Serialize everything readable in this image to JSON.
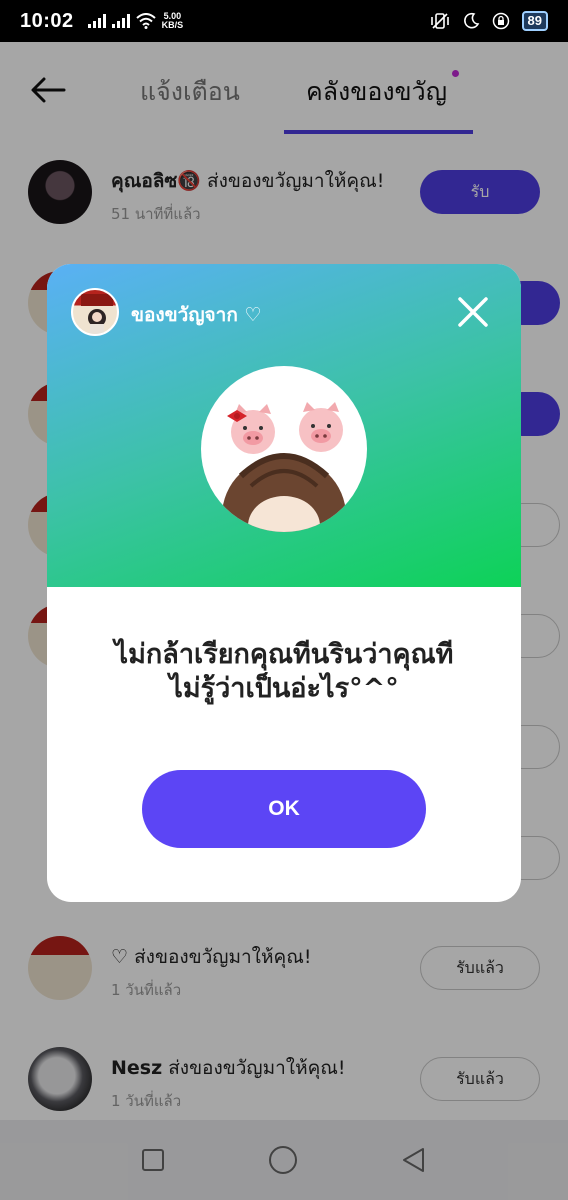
{
  "status_bar": {
    "time": "10:02",
    "speed_value": "5.00",
    "speed_unit": "KB/S",
    "battery": "89"
  },
  "header": {
    "tabs": [
      {
        "label": "แจ้งเตือน"
      },
      {
        "label": "คลังของขวัญ"
      }
    ]
  },
  "list": [
    {
      "sender": "คุณอลิซ🔞",
      "action": " ส่งของขวัญมาให้คุณ!",
      "time": "51 นาทีที่แล้ว",
      "button": "รับ",
      "avatar": "dark"
    },
    {
      "sender": "♡",
      "action": " ส่งของขวัญมาให้คุณ!",
      "time": "1 วันที่แล้ว",
      "button": "รับแล้ว",
      "avatar": "room"
    },
    {
      "sender": "Nesz",
      "action": " ส่งของขวัญมาให้คุณ!",
      "time": "1 วันที่แล้ว",
      "button": "รับแล้ว",
      "avatar": "grey"
    }
  ],
  "modal": {
    "title": "ของขวัญจาก ♡",
    "message_line1": "ไม่กล้าเรียกคุณทีนรินว่าคุณที",
    "message_line2": "ไม่รู้ว่าเป็นอ่ะไร°^°",
    "ok_label": "OK"
  },
  "colors": {
    "accent": "#4d3ce0",
    "ok_button": "#5c45f5",
    "gradient_top": "#5ab0f5",
    "gradient_bottom": "#0dd257"
  }
}
